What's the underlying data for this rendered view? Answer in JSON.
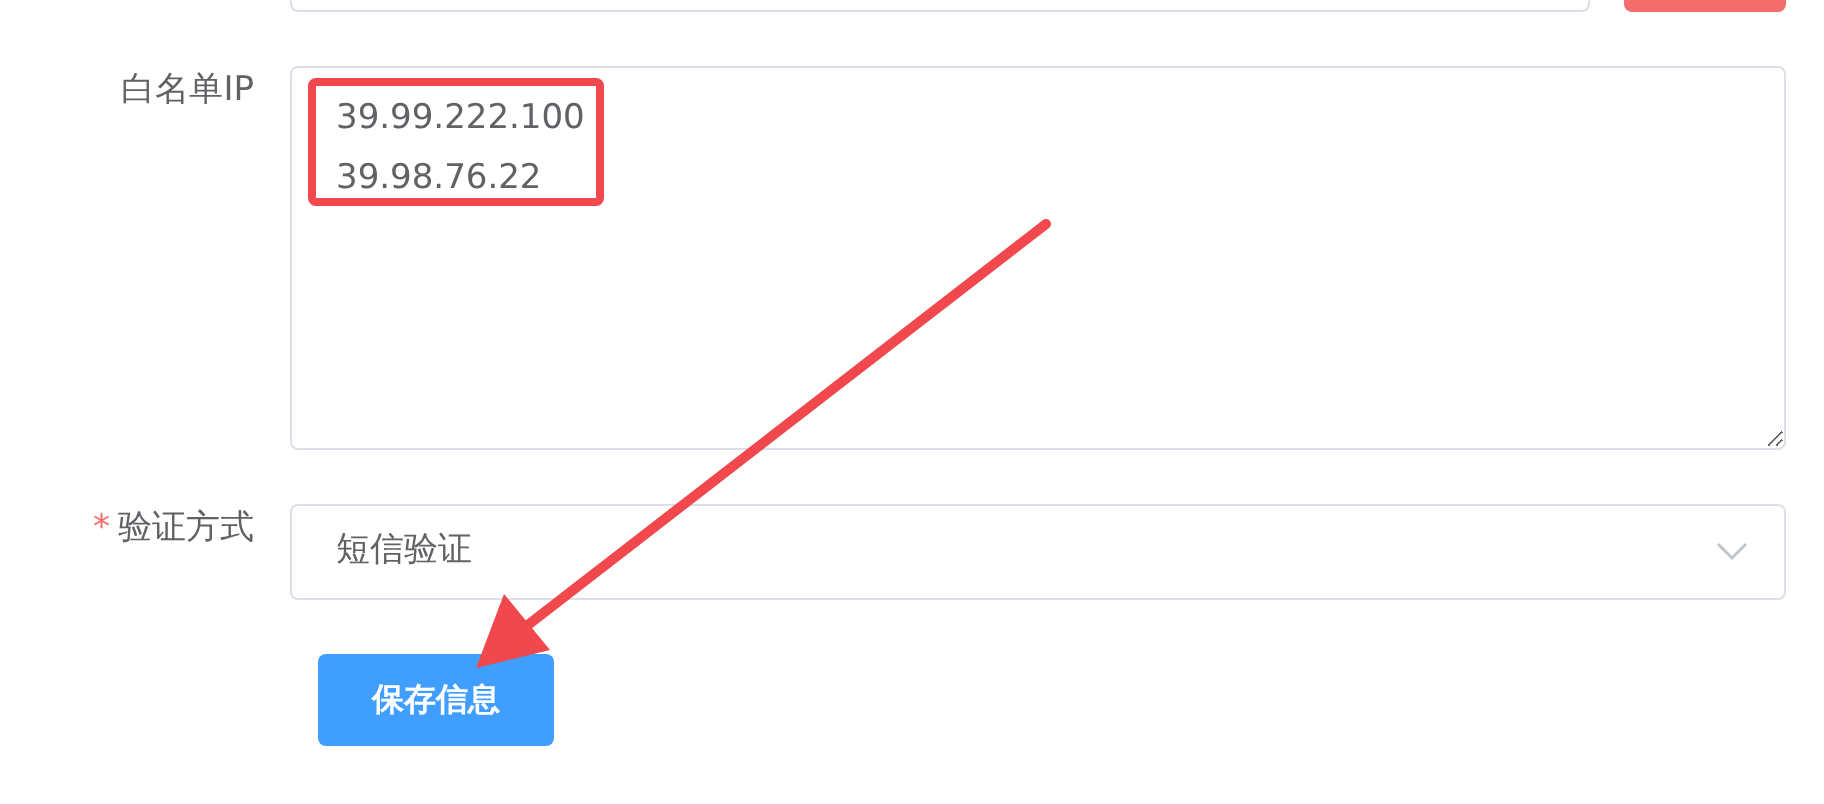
{
  "fields": [
    {
      "kind": "textarea",
      "label": "白名单IP",
      "value": "39.99.222.100\n39.98.76.22"
    },
    {
      "kind": "select",
      "label": "验证方式",
      "required_mark": "*",
      "value": "短信验证"
    }
  ],
  "submit": "保存信息"
}
